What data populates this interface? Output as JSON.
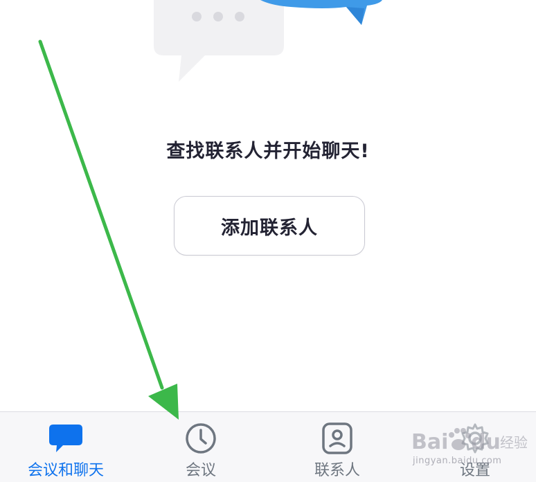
{
  "empty_state": {
    "title": "查找联系人并开始聊天!",
    "add_contact_label": "添加联系人"
  },
  "tabs": [
    {
      "label": "会议和聊天",
      "icon": "chat-bubble-icon",
      "active": true
    },
    {
      "label": "会议",
      "icon": "clock-icon",
      "active": false
    },
    {
      "label": "联系人",
      "icon": "contact-card-icon",
      "active": false
    },
    {
      "label": "设置",
      "icon": "gear-icon",
      "active": false
    }
  ],
  "watermark": {
    "text": "Bai du 经验",
    "sub": "jingyan.baidu.com"
  },
  "colors": {
    "accent": "#0e72ed",
    "inactive": "#6e7680",
    "arrow": "#3cb84a"
  }
}
